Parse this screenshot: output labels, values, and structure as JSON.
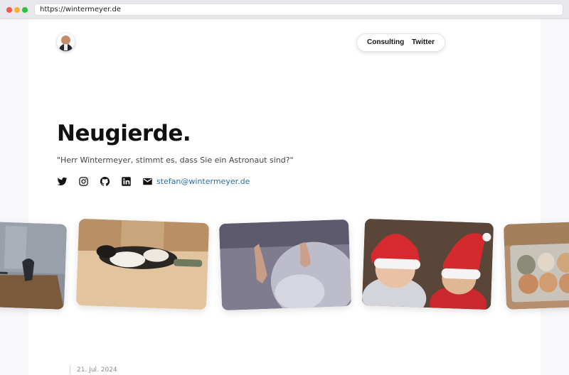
{
  "browser": {
    "url": "https://wintermeyer.de"
  },
  "header": {
    "avatar_icon": "profile-photo",
    "nav": [
      {
        "label": "Consulting"
      },
      {
        "label": "Twitter"
      }
    ]
  },
  "hero": {
    "title": "Neugierde.",
    "subtitle": "\"Herr Wintermeyer, stimmt es, dass Sie ein Astronaut sind?\""
  },
  "social": {
    "icons": [
      "twitter-icon",
      "instagram-icon",
      "github-icon",
      "linkedin-icon",
      "mail-icon"
    ],
    "email": "stefan@wintermeyer.de"
  },
  "photos": [
    {
      "subject": "office-desk-chair"
    },
    {
      "subject": "dog-sleeping-on-floor"
    },
    {
      "subject": "baby-feet-on-blanket"
    },
    {
      "subject": "children-in-santa-hats"
    },
    {
      "subject": "eggs-in-carton"
    }
  ],
  "post": {
    "date": "21. Jul. 2024"
  },
  "colors": {
    "link": "#2a6ea8",
    "text": "#111111",
    "background": "#ffffff"
  }
}
